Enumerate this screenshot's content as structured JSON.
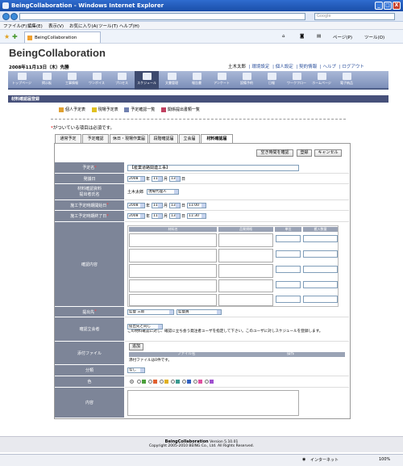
{
  "window": {
    "title": "BeingCollaboration - Windows Internet Explorer",
    "minimize": "_",
    "maximize": "□",
    "close": "X"
  },
  "addressbar": {
    "search_placeholder": "Google"
  },
  "menubar": {
    "items": [
      "ファイル(F)",
      "編集(E)",
      "表示(V)",
      "お気に入り(A)",
      "ツール(T)",
      "ヘルプ(H)"
    ]
  },
  "browser_tab": {
    "label": "BeingCollaboration"
  },
  "toolbar_right": {
    "page_label": "ページ(P)",
    "tools_label": "ツール(O)"
  },
  "app": {
    "logo": "BeingCollaboration",
    "date": "2008年11月13日（木）先勝",
    "user": "土木太郎",
    "links": [
      "環境設定",
      "個人設定",
      "契約情報",
      "ヘルプ",
      "ログアウト"
    ]
  },
  "iconbar": {
    "items": [
      "トップページ",
      "掲示板",
      "工事情報",
      "ワンボイス",
      "プロセス",
      "スケジュール",
      "文書管理",
      "報告書",
      "アンケート",
      "設備予約",
      "日報",
      "ワークフロー",
      "ホームページ",
      "電子納品"
    ],
    "active_index": 5
  },
  "section_title": "材料確認届登録",
  "subnav": {
    "items": [
      "個人予定表",
      "現場予定表",
      "予定確認一覧",
      "関係提出書類一覧"
    ],
    "colors": [
      "#e0a030",
      "#e0c020",
      "#7080b0",
      "#c04060"
    ]
  },
  "required_note": {
    "star": "*",
    "text": "がついている項目は必須です。"
  },
  "form_tabs": [
    "通常予定",
    "予定確認",
    "休日・現場作業届",
    "段階確認届",
    "立会届",
    "材料確認届"
  ],
  "form_tabs_active": 5,
  "buttons": {
    "check_time": "空き時間を確認",
    "register": "登録",
    "cancel": "キャンセル",
    "add": "追加"
  },
  "fields": {
    "title": {
      "label": "予定名",
      "value": "【産業道路関連工事】"
    },
    "date": {
      "label": "発議日",
      "year": "2008",
      "month": "11",
      "day": "13",
      "year_unit": "年",
      "month_unit": "月",
      "day_unit": "日"
    },
    "submitter": {
      "label_line1": "材料確認資料",
      "label_line2": "提出者氏名",
      "name": "土木太郎",
      "role": "現場代理人"
    },
    "start": {
      "label": "施工予定時期開始日",
      "year": "2008",
      "month": "11",
      "day": "13",
      "time": "11:00"
    },
    "end": {
      "label": "施工予定時期終了日",
      "year": "2008",
      "month": "11",
      "day": "13",
      "time": "11:30"
    },
    "content": {
      "label": "確認内容",
      "columns": [
        "材料名",
        "品質規格",
        "単位",
        "搬入数量"
      ],
      "rows": 5
    },
    "recipient": {
      "label": "提出先",
      "supervisor_name": "監督 三郎",
      "supervisor_role": "監督員"
    },
    "witness": {
      "label": "確認立会者",
      "select": "提出先と同じ",
      "note": "この材料確認に対し、確認に立ち会う発注者ユーザを指定して下さい。このユーザに対しスケジュールを登録します。"
    },
    "attachment": {
      "label": "添付ファイル",
      "col_filename": "ファイル名",
      "col_action": "操作",
      "empty_text": "添付ファイルは0件です。"
    },
    "category": {
      "label": "分類",
      "value": "なし"
    },
    "color": {
      "label": "色",
      "swatches": [
        "#4aa03a",
        "#e06030",
        "#e0b020",
        "#3a9a90",
        "#3060c0",
        "#e050a0",
        "#a050d0"
      ]
    },
    "description": {
      "label": "内容"
    }
  },
  "footer": {
    "app": "BeingCollaboration",
    "version": "Version 5.10.01",
    "copyright": "Copyright 2005-2010 BEING Co., Ltd. All Rights Reserved."
  },
  "statusbar": {
    "zone": "インターネット",
    "zoom": "100%"
  }
}
